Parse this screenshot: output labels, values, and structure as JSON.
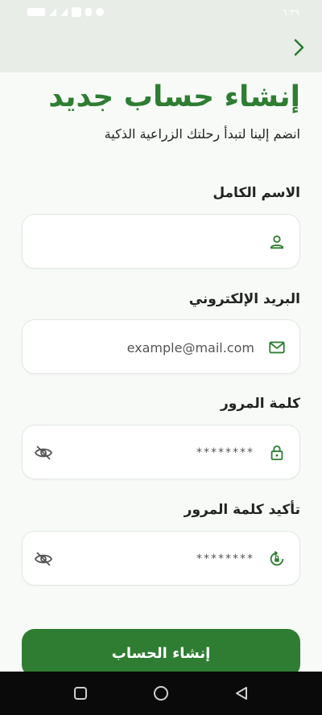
{
  "status_bar": {
    "time": "٦:٣٩"
  },
  "header": {
    "back_icon": "chevron-right-icon"
  },
  "page": {
    "title": "إنشاء حساب جديد",
    "subtitle": "انضم إلينا لتبدأ رحلتك الزراعية الذكية"
  },
  "form": {
    "full_name": {
      "label": "الاسم الكامل",
      "value": "",
      "icon": "person-icon"
    },
    "email": {
      "label": "البريد الإلكتروني",
      "placeholder": "example@mail.com",
      "icon": "mail-icon"
    },
    "password": {
      "label": "كلمة المرور",
      "value": "********",
      "icon": "lock-icon",
      "toggle_icon": "eye-off-icon"
    },
    "confirm_password": {
      "label": "تأكيد كلمة المرور",
      "value": "********",
      "icon": "lock-reset-icon",
      "toggle_icon": "eye-off-icon"
    },
    "submit_label": "إنشاء الحساب"
  },
  "colors": {
    "primary": "#2e7d32",
    "header_bg": "#e8ede8",
    "page_bg": "#f7faf7"
  }
}
